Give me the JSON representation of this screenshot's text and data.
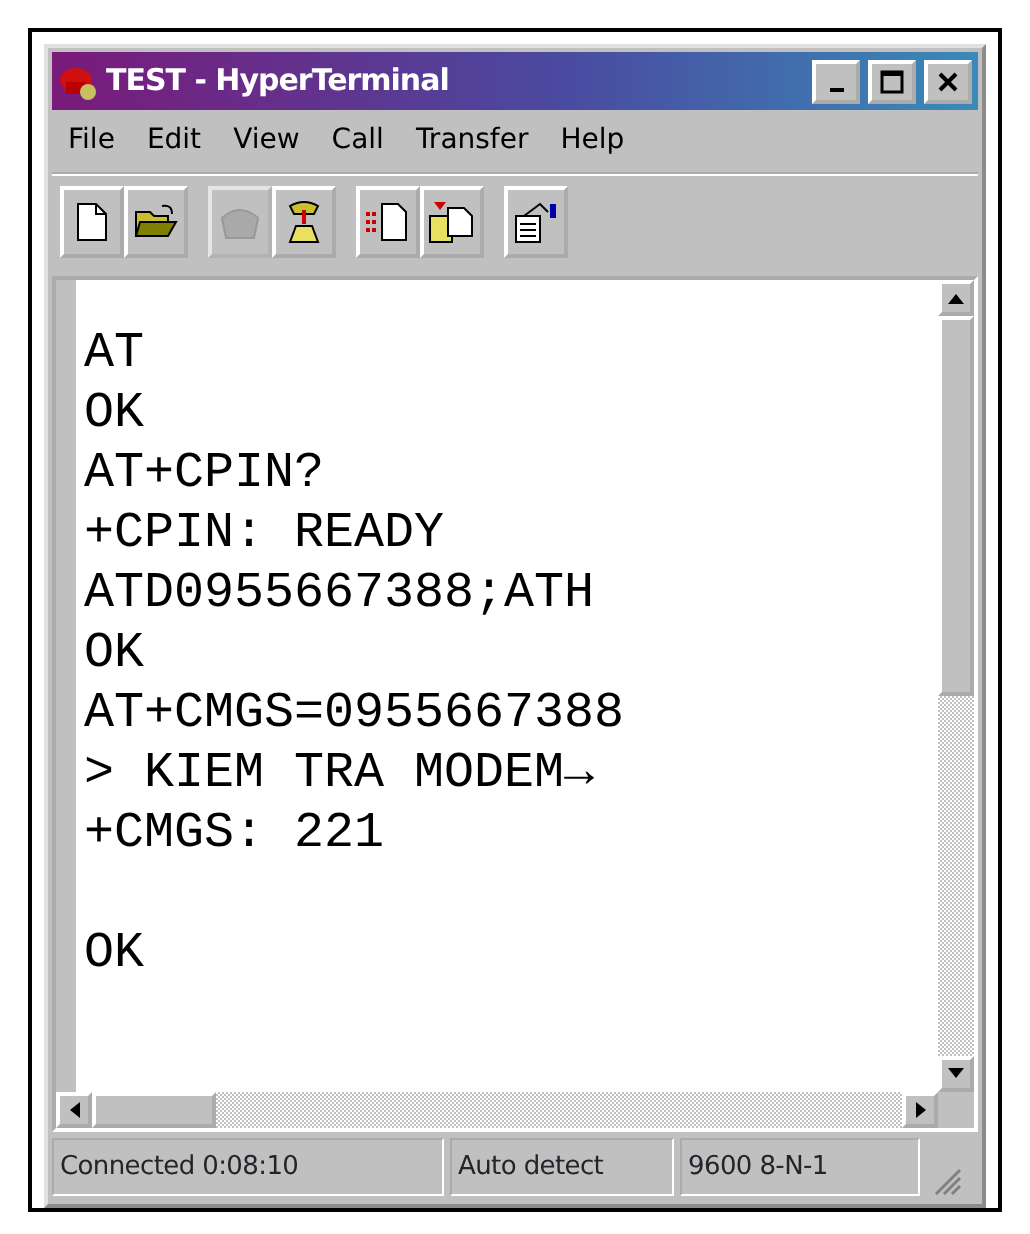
{
  "window": {
    "title": "TEST - HyperTerminal"
  },
  "menu": [
    "File",
    "Edit",
    "View",
    "Call",
    "Transfer",
    "Help"
  ],
  "toolbar": [
    {
      "kind": "new",
      "disabled": false
    },
    {
      "kind": "open",
      "disabled": false
    },
    {
      "kind": "disconnect",
      "disabled": true
    },
    {
      "kind": "dial",
      "disabled": false
    },
    {
      "kind": "send",
      "disabled": false
    },
    {
      "kind": "receive",
      "disabled": false
    },
    {
      "kind": "properties",
      "disabled": false
    }
  ],
  "terminal": {
    "blocks": [
      [
        "AT",
        "OK",
        "AT+CPIN?",
        "+CPIN: READY",
        "ATD0955667388;ATH",
        "OK",
        "AT+CMGS=0955667388",
        "> KIEM TRA MODEM→",
        "+CMGS: 221"
      ],
      [
        "OK"
      ]
    ]
  },
  "status_bar": [
    "Connected 0:08:10",
    "Auto detect",
    "9600 8-N-1"
  ]
}
